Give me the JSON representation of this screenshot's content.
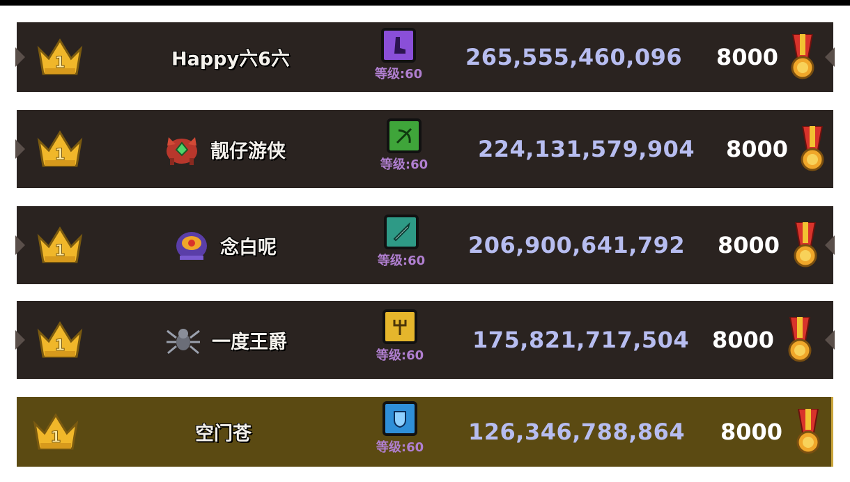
{
  "leaderboard": {
    "rows": [
      {
        "rank_badge": "1",
        "name": "Happy六6六",
        "avatar_icon": null,
        "class_icon": "purple-boot-icon",
        "class_color": "#8a4fd8",
        "level": "等级:60",
        "power": "265,555,460,096",
        "score": "8000",
        "medal_icon": "gold-medal-icon",
        "highlighted": false
      },
      {
        "rank_badge": "1",
        "name": "靓仔游侠",
        "avatar_icon": "red-crab-boss-avatar",
        "class_icon": "green-bow-icon",
        "class_color": "#3fa53a",
        "level": "等级:60",
        "power": "224,131,579,904",
        "score": "8000",
        "medal_icon": "gold-medal-icon",
        "highlighted": false
      },
      {
        "rank_badge": "1",
        "name": "念白呢",
        "avatar_icon": "purple-orb-beast-avatar",
        "class_icon": "teal-sword-icon",
        "class_color": "#2e9a86",
        "level": "等级:60",
        "power": "206,900,641,792",
        "score": "8000",
        "medal_icon": "gold-medal-icon",
        "highlighted": false
      },
      {
        "rank_badge": "1",
        "name": "一度王爵",
        "avatar_icon": "grey-spider-avatar",
        "class_icon": "yellow-trident-icon",
        "class_color": "#e5b62c",
        "level": "等级:60",
        "power": "175,821,717,504",
        "score": "8000",
        "medal_icon": "gold-medal-icon",
        "highlighted": false
      },
      {
        "rank_badge": "1",
        "name": "空门苍",
        "avatar_icon": null,
        "class_icon": "blue-shield-icon",
        "class_color": "#2f8fd8",
        "level": "等级:60",
        "power": "126,346,788,864",
        "score": "8000",
        "medal_icon": "gold-medal-icon",
        "highlighted": true
      }
    ]
  },
  "colors": {
    "row_bg": "#2a2320",
    "highlight_bg": "#5b4a12",
    "power_text": "#b7bdf0",
    "level_text": "#b07fd0",
    "crown_gold": "#f0b72a"
  }
}
